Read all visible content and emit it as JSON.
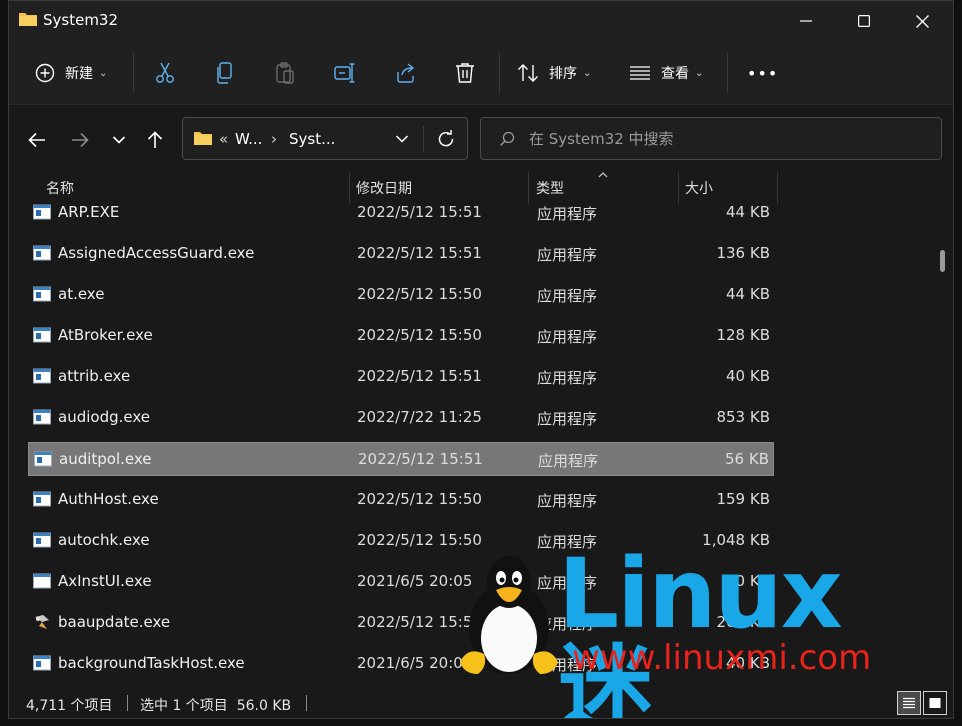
{
  "window": {
    "title": "System32"
  },
  "toolbar": {
    "new_label": "新建",
    "sort_label": "排序",
    "view_label": "查看",
    "more_label": "•••"
  },
  "address": {
    "chevrons": "«",
    "seg1": "W...",
    "sep": "›",
    "seg2": "Syst..."
  },
  "search": {
    "placeholder": "在 System32 中搜索"
  },
  "columns": {
    "name": "名称",
    "date": "修改日期",
    "type": "类型",
    "size": "大小"
  },
  "files": [
    {
      "name": "ARP.EXE",
      "date": "2022/5/12 15:51",
      "type": "应用程序",
      "size": "44 KB",
      "icon": "exe-window-icon"
    },
    {
      "name": "AssignedAccessGuard.exe",
      "date": "2022/5/12 15:51",
      "type": "应用程序",
      "size": "136 KB",
      "icon": "exe-window-icon"
    },
    {
      "name": "at.exe",
      "date": "2022/5/12 15:50",
      "type": "应用程序",
      "size": "44 KB",
      "icon": "exe-window-icon"
    },
    {
      "name": "AtBroker.exe",
      "date": "2022/5/12 15:50",
      "type": "应用程序",
      "size": "128 KB",
      "icon": "exe-window-icon"
    },
    {
      "name": "attrib.exe",
      "date": "2022/5/12 15:51",
      "type": "应用程序",
      "size": "40 KB",
      "icon": "exe-window-icon"
    },
    {
      "name": "audiodg.exe",
      "date": "2022/7/22 11:25",
      "type": "应用程序",
      "size": "853 KB",
      "icon": "exe-window-icon"
    },
    {
      "name": "auditpol.exe",
      "date": "2022/5/12 15:51",
      "type": "应用程序",
      "size": "56 KB",
      "icon": "exe-window-icon",
      "selected": true
    },
    {
      "name": "AuthHost.exe",
      "date": "2022/5/12 15:50",
      "type": "应用程序",
      "size": "159 KB",
      "icon": "exe-window-icon"
    },
    {
      "name": "autochk.exe",
      "date": "2022/5/12 15:50",
      "type": "应用程序",
      "size": "1,048 KB",
      "icon": "exe-window-icon"
    },
    {
      "name": "AxInstUI.exe",
      "date": "2021/6/5 20:05",
      "type": "应用程序",
      "size": "80 KB",
      "icon": "exe-plain-window-icon"
    },
    {
      "name": "baaupdate.exe",
      "date": "2022/5/12 15:51",
      "type": "应用程序",
      "size": "263 KB",
      "icon": "exe-update-icon"
    },
    {
      "name": "backgroundTaskHost.exe",
      "date": "2021/6/5 20:05",
      "type": "应用程序",
      "size": "40 KB",
      "icon": "exe-window-icon"
    }
  ],
  "status": {
    "item_count": "4,711 个项目",
    "selection": "选中 1 个项目  56.0 KB"
  },
  "watermark": {
    "logo": "Linux迷",
    "url": "www.linuxmi.com"
  },
  "colors": {
    "background": "#191919",
    "selection": "#777777",
    "folder": "#f2c14e",
    "accent_logo": "#1aa7e8",
    "accent_url": "#e8231c"
  }
}
